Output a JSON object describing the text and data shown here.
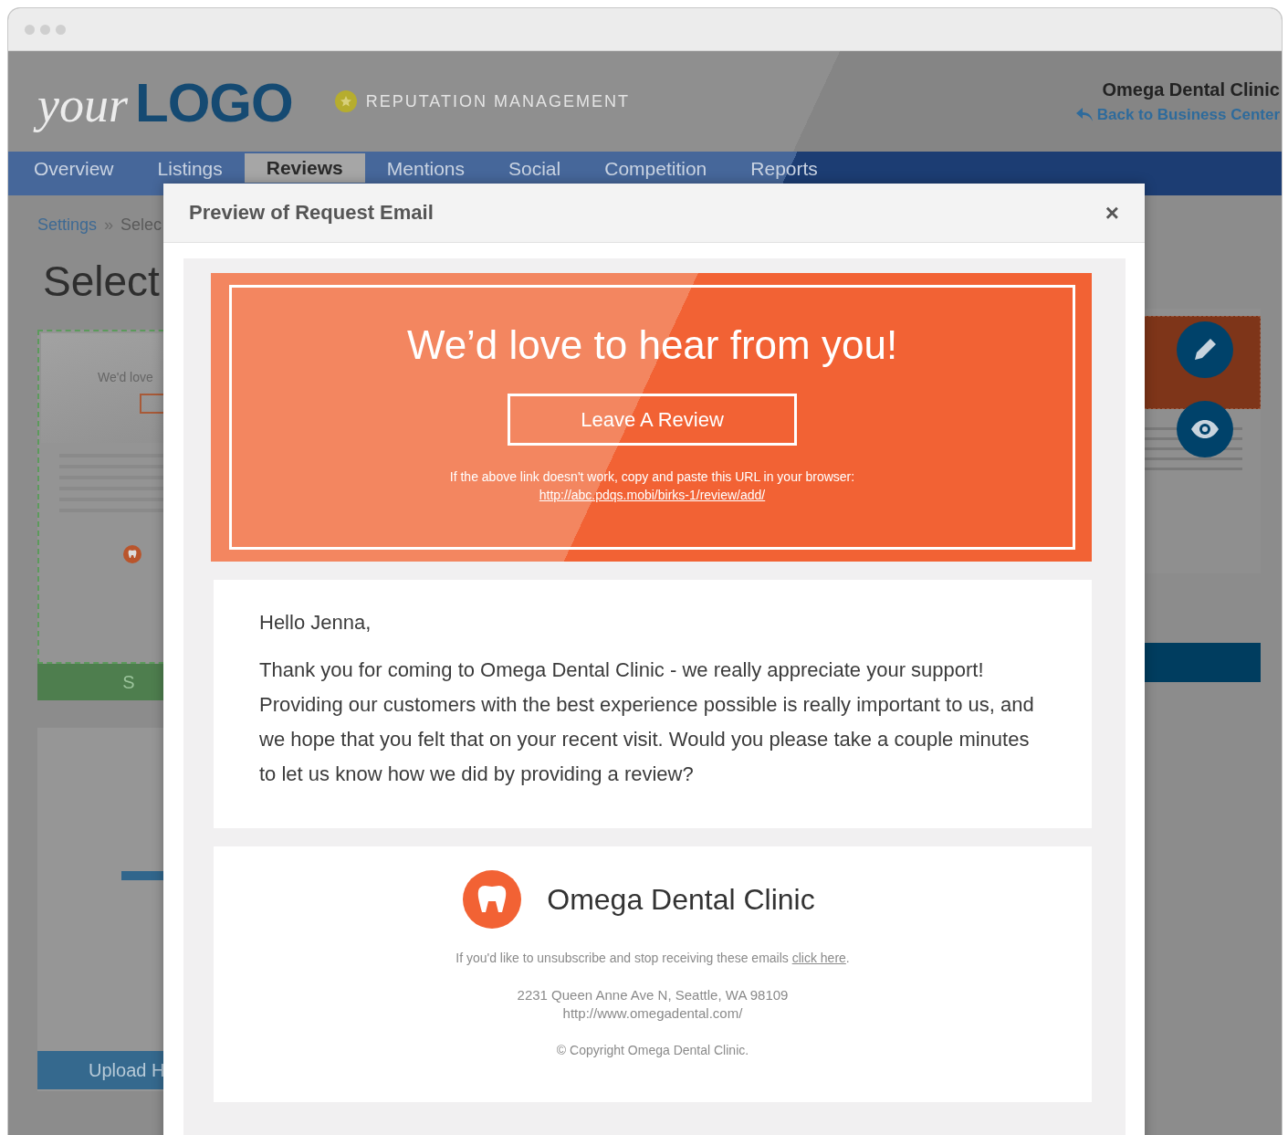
{
  "header": {
    "logo_light": "your",
    "logo_bold": "LOGO",
    "product": "REPUTATION MANAGEMENT",
    "business": "Omega Dental Clinic",
    "back_link": "Back to Business Center"
  },
  "tabs": [
    {
      "label": "Overview",
      "selected": false
    },
    {
      "label": "Listings",
      "selected": false
    },
    {
      "label": "Reviews",
      "selected": true
    },
    {
      "label": "Mentions",
      "selected": false
    },
    {
      "label": "Social",
      "selected": false
    },
    {
      "label": "Competition",
      "selected": false
    },
    {
      "label": "Reports",
      "selected": false
    }
  ],
  "breadcrumb": [
    {
      "label": "Settings",
      "kind": "link"
    },
    {
      "label": "»",
      "kind": "separator"
    },
    {
      "label": "Selec",
      "kind": "current"
    }
  ],
  "page_title": "Select",
  "templates": [
    {
      "selected": true,
      "thumb_text": "We'd love",
      "button": "S"
    },
    {
      "selected": false
    }
  ],
  "upload": {
    "button": "Upload H"
  },
  "modal": {
    "title": "Preview of Request Email",
    "close": "×",
    "email": {
      "headline": "We’d love to hear from you!",
      "button": "Leave A Review",
      "fallback": "If the above link doesn't work, copy and paste this URL in your browser:",
      "url": "http://abc.pdqs.mobi/birks-1/review/add/",
      "greeting": "Hello Jenna,",
      "body": "Thank you for coming to Omega Dental Clinic - we really appreciate your support! Providing our customers with the best experience possible is really important to us, and we hope that you felt that on your recent visit. Would you please take a couple minutes to let us know how we did by providing a review?",
      "clinic": "Omega Dental Clinic",
      "unsubscribe": "If you'd like to unsubscribe and stop receiving these emails ",
      "unsubscribe_link": "click here",
      "unsubscribe_end": ".",
      "address": "2231 Queen Anne Ave N, Seattle, WA 98109",
      "website": "http://www.omegadental.com/",
      "copyright": "© Copyright Omega Dental Clinic."
    }
  }
}
